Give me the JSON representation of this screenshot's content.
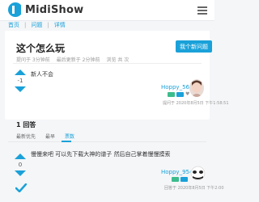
{
  "header": {
    "brand": "MidiShow",
    "logo_icon": "midishow-logo",
    "menu_icon": "menu-icon"
  },
  "breadcrumb": [
    "首页",
    "问题",
    "详情"
  ],
  "question": {
    "title": "这个怎么玩",
    "ask_button": "我个新问题",
    "meta": [
      "提问于 3分钟前",
      "最后更新于 2分钟前",
      "浏览 共 次"
    ],
    "votes": "-1",
    "body": "新人不会",
    "author": "Hoppy_564719",
    "asked_time": "提问于 2020年8月5日 下午1:58:51"
  },
  "answers": {
    "count_label": "1 回答",
    "tabs": [
      "最新优先",
      "最早",
      "票数"
    ],
    "active_tab": 2,
    "items": [
      {
        "votes": "0",
        "body": "慢慢来吧 可以先下载大神的谱子 然后自己掌着慢慢摸索",
        "author": "Hoppy_954111",
        "time": "回答于 2020年8月5日 下午2:00",
        "accepted": true
      }
    ]
  },
  "colors": {
    "accent": "#1aa1d9",
    "badge_green": "#3cbc8d",
    "accepted_check": "#1aa1d9"
  }
}
